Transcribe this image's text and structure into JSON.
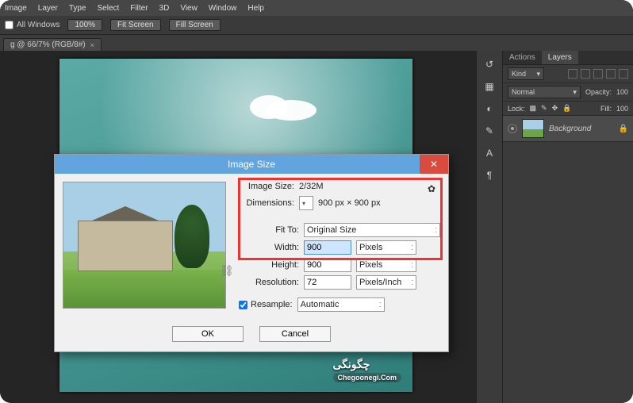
{
  "menu": [
    "Image",
    "Layer",
    "Type",
    "Select",
    "Filter",
    "3D",
    "View",
    "Window",
    "Help"
  ],
  "toolbar": {
    "all_windows": "All Windows",
    "zoom": "100%",
    "fit": "Fit Screen",
    "fill": "Fill Screen"
  },
  "tab": {
    "label": "g @ 66/7% (RGB/8#)"
  },
  "watermark": {
    "text": "چگونگی",
    "url": "Chegoonegi.Com"
  },
  "dialog": {
    "title": "Image Size",
    "size_label": "Image Size:",
    "size_value": "2/32M",
    "dim_label": "Dimensions:",
    "dim_value": "900 px × 900 px",
    "fit_label": "Fit To:",
    "fit_value": "Original Size",
    "width_label": "Width:",
    "width_value": "900",
    "height_label": "Height:",
    "height_value": "900",
    "res_label": "Resolution:",
    "res_value": "72",
    "unit_px": "Pixels",
    "unit_ppi": "Pixels/Inch",
    "resample_label": "Resample:",
    "resample_value": "Automatic",
    "ok": "OK",
    "cancel": "Cancel"
  },
  "panel": {
    "tabs": {
      "actions": "Actions",
      "layers": "Layers"
    },
    "kind": "Kind",
    "blend": "Normal",
    "opacity_label": "Opacity:",
    "opacity": "100",
    "lock_label": "Lock:",
    "fill_label": "Fill:",
    "fill": "100",
    "layer_name": "Background"
  }
}
